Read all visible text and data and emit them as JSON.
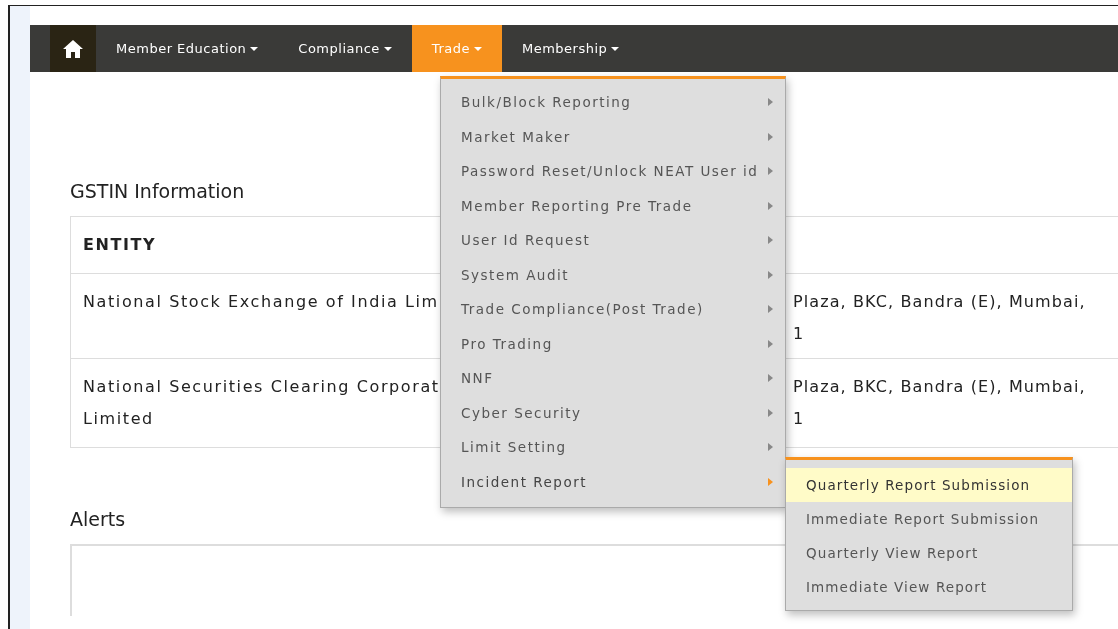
{
  "nav": {
    "items": [
      {
        "label": "Member Education",
        "selected": false
      },
      {
        "label": "Compliance",
        "selected": false
      },
      {
        "label": "Trade",
        "selected": true
      },
      {
        "label": "Membership",
        "selected": false
      }
    ]
  },
  "gstin": {
    "title": "GSTIN Information",
    "columns": [
      "ENTITY"
    ],
    "rows": [
      {
        "entity": "National Stock Exchange of India Lim",
        "address": [
          "Plaza, BKC, Bandra (E), Mumbai,",
          "1"
        ]
      },
      {
        "entity": "National Securities Clearing Corporat\nLimited",
        "address": [
          "Plaza, BKC, Bandra (E), Mumbai,",
          "1"
        ]
      }
    ]
  },
  "alerts": {
    "title": "Alerts"
  },
  "trade_menu": {
    "items": [
      {
        "label": "Bulk/Block Reporting",
        "selected": false
      },
      {
        "label": "Market Maker",
        "selected": false
      },
      {
        "label": "Password Reset/Unlock NEAT User id",
        "selected": false
      },
      {
        "label": "Member Reporting Pre Trade",
        "selected": false
      },
      {
        "label": "User Id Request",
        "selected": false
      },
      {
        "label": "System Audit",
        "selected": false
      },
      {
        "label": "Trade Compliance(Post Trade)",
        "selected": false
      },
      {
        "label": "Pro Trading",
        "selected": false
      },
      {
        "label": "NNF",
        "selected": false
      },
      {
        "label": "Cyber Security",
        "selected": false
      },
      {
        "label": "Limit Setting",
        "selected": false
      },
      {
        "label": "Incident Report",
        "selected": true
      }
    ]
  },
  "incident_submenu": {
    "items": [
      {
        "label": "Quarterly Report Submission",
        "selected": true
      },
      {
        "label": "Immediate Report Submission",
        "selected": false
      },
      {
        "label": "Quarterly View Report",
        "selected": false
      },
      {
        "label": "Immediate View Report",
        "selected": false
      }
    ]
  }
}
